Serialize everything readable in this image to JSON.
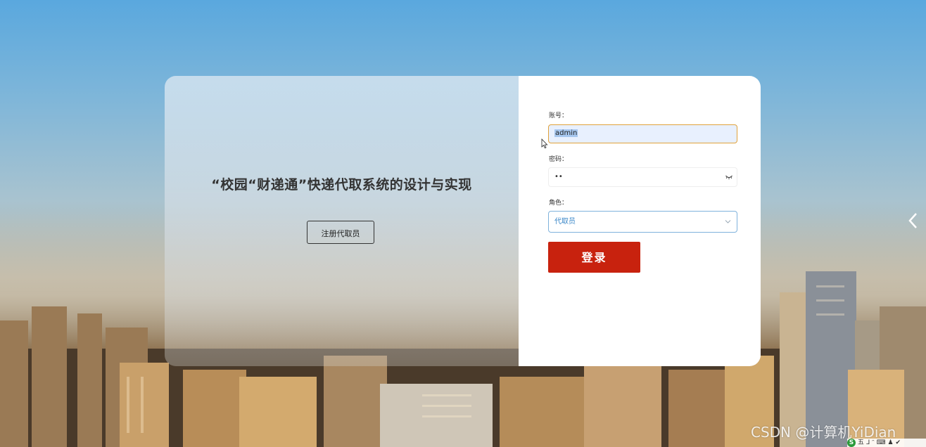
{
  "system": {
    "title": "“校园“财递通”快递代取系统的设计与实现",
    "register_label": "注册代取员"
  },
  "login_form": {
    "username_label": "账号：",
    "username_value": "admin",
    "password_label": "密码：",
    "password_value": "••",
    "role_label": "角色：",
    "role_value": "代取员",
    "submit_label": "登录"
  },
  "watermark": {
    "text": "CSDN @计算机YiDian"
  },
  "ime": {
    "logo": "S",
    "text": "五 ᒧ ᵔ ⌨ ♟ ✔"
  },
  "colors": {
    "accent": "#c8220e",
    "role_text": "#3a87c8",
    "username_border": "#e0a23a"
  }
}
